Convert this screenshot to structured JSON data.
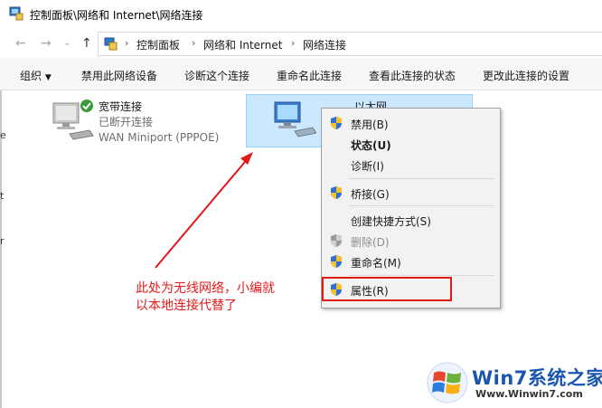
{
  "window": {
    "title": "控制面板\\网络和 Internet\\网络连接"
  },
  "address": {
    "crumbs": [
      "控制面板",
      "网络和 Internet",
      "网络连接"
    ]
  },
  "toolbar": {
    "organize": "组织",
    "items": [
      "禁用此网络设备",
      "诊断这个连接",
      "重命名此连接",
      "查看此连接的状态",
      "更改此连接的设置"
    ]
  },
  "connections": [
    {
      "name": "宽带连接",
      "status": "已断开连接",
      "device": "WAN Miniport (PPPOE)",
      "state_icon": "check-icon"
    },
    {
      "name": "以太网"
    }
  ],
  "context_menu": {
    "items": [
      {
        "label": "禁用(B)",
        "shield": true
      },
      {
        "label": "状态(U)",
        "bold": true
      },
      {
        "label": "诊断(I)"
      },
      {
        "label": "桥接(G)",
        "shield": true
      },
      {
        "label": "创建快捷方式(S)"
      },
      {
        "label": "删除(D)",
        "shield": true,
        "disabled": true
      },
      {
        "label": "重命名(M)",
        "shield": true
      },
      {
        "label": "属性(R)",
        "shield": true
      }
    ]
  },
  "annotation": {
    "line1": "此处为无线网络，小编就",
    "line2": "以本地连接代替了",
    "color": "#e11919"
  },
  "watermark": {
    "brand": "Win7系统之家",
    "url": "Www.Winwin7.com"
  }
}
